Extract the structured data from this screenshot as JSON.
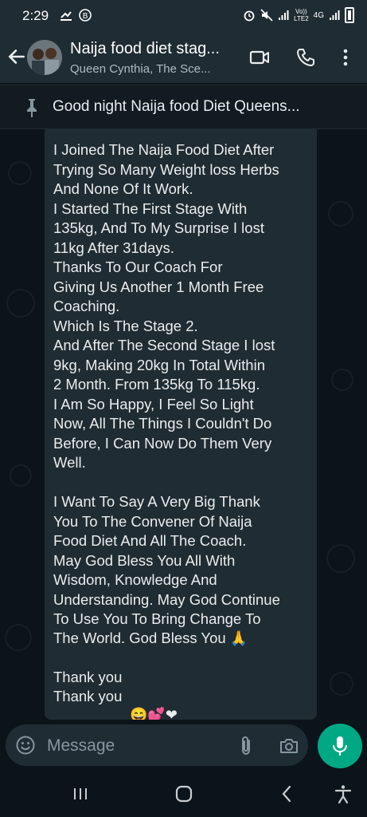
{
  "status_bar": {
    "time": "2:29",
    "network_label_top": "Vo))",
    "network_label_bottom": "LTE2",
    "network_type": "4G",
    "icons": [
      "whatsapp-notification-icon",
      "b-badge-icon",
      "alarm-icon",
      "mute-icon",
      "signal-icon",
      "battery-icon"
    ]
  },
  "header": {
    "title": "Naija food diet stag...",
    "subtitle": "Queen Cynthia, The Sce...",
    "icons": [
      "back-arrow-icon",
      "video-call-icon",
      "voice-call-icon",
      "more-options-icon"
    ]
  },
  "pinned": {
    "text": "Good night Naija food Diet Queens..."
  },
  "message": {
    "lines": [
      "I Joined The Naija Food Diet After",
      "Trying So Many Weight loss Herbs",
      "And None Of It Work.",
      "I Started The First Stage  With",
      "135kg, And To My Surprise I lost",
      "11kg After 31days.",
      "Thanks To Our Coach For",
      "Giving Us Another 1 Month Free",
      "Coaching.",
      "Which Is The Stage 2.",
      "And After The Second Stage I lost",
      "9kg, Making 20kg In Total Within",
      "2 Month. From 135kg To 115kg.",
      "I Am So Happy, I Feel So Light",
      "Now, All The Things I Couldn't Do",
      "Before, I Can Now Do Them Very",
      "Well.",
      "",
      "I Want To Say A Very Big Thank",
      "You To The Convener Of Naija",
      "Food Diet And All The Coach.",
      "May God Bless You All With",
      "Wisdom, Knowledge And",
      "Understanding. May God Continue",
      "To Use You  To Bring Change To",
      "The World. God Bless You"
    ],
    "praying_emoji": "🙏",
    "closing_lines": [
      "Thank you",
      "Thank you"
    ],
    "cutoff_emojis": "😄💕❤"
  },
  "input": {
    "placeholder": "Message",
    "icons": [
      "emoji-icon",
      "attach-icon",
      "camera-icon",
      "mic-icon"
    ]
  },
  "nav": {
    "icons": [
      "recent-apps-icon",
      "home-icon",
      "back-icon",
      "accessibility-icon"
    ]
  },
  "colors": {
    "header_bg": "#1f2c34",
    "chat_bg": "#0b141a",
    "bubble_bg": "#202c33",
    "accent_green": "#00a884",
    "text_primary": "#e9edef",
    "text_secondary": "#8696a0"
  }
}
